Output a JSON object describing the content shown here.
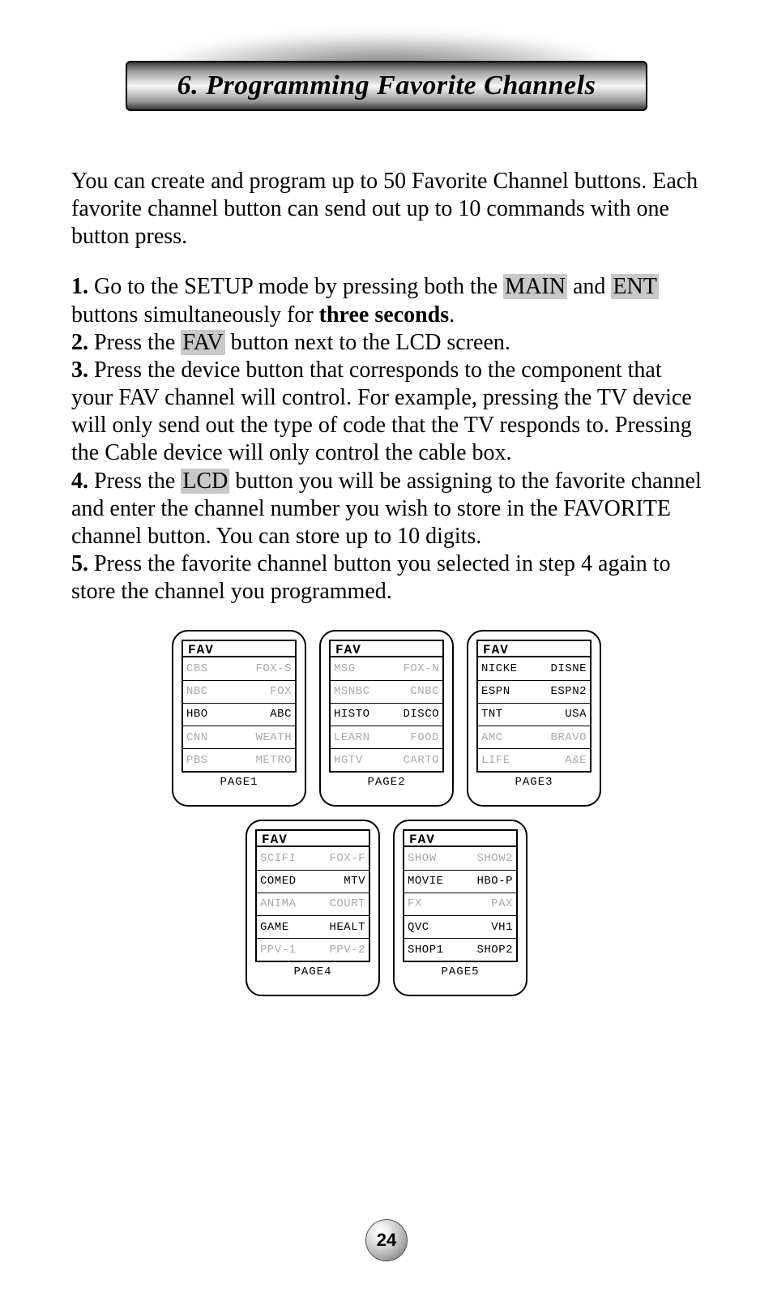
{
  "title": "6. Programming Favorite Channels",
  "intro": "You can create and program up to 50 Favorite Channel buttons. Each favorite channel button can send out up to 10 commands with one button press.",
  "steps": {
    "s1a": "1.",
    "s1b": " Go to the  SETUP mode by pressing both the ",
    "s1_main": "MAIN",
    "s1c": " and ",
    "s1_ent": "ENT",
    "s1d": " buttons simultaneously for ",
    "s1_three": "three seconds",
    "s1e": ".",
    "s2a": "2.",
    "s2b": " Press the ",
    "s2_fav": "FAV",
    "s2c": " button next to the LCD screen.",
    "s3a": "3.",
    "s3b": " Press the device button that corresponds to the component that your FAV channel will control. For example, pressing the TV device will only send out the type of code that the TV responds to. Pressing the Cable device will only control the cable box.",
    "s4a": "4.",
    "s4b": " Press the ",
    "s4_lcd": "LCD",
    "s4c": " button you will be assigning to the favorite channel and enter the channel number you wish to store in the FAVORITE channel button. You can store up to 10 digits.",
    "s5a": "5.",
    "s5b": " Press the favorite channel button you selected in step 4 again to store the channel you programmed."
  },
  "lcd_title": "FAV",
  "pages": [
    {
      "label": "PAGE1",
      "rows": [
        {
          "l": "CBS",
          "r": "FOX-S",
          "dim": true
        },
        {
          "l": "NBC",
          "r": "FOX",
          "dim": true
        },
        {
          "l": "HBO",
          "r": "ABC",
          "dim": false
        },
        {
          "l": "CNN",
          "r": "WEATH",
          "dim": true
        },
        {
          "l": "PBS",
          "r": "METRO",
          "dim": true
        }
      ]
    },
    {
      "label": "PAGE2",
      "rows": [
        {
          "l": "MSG",
          "r": "FOX-N",
          "dim": true
        },
        {
          "l": "MSNBC",
          "r": "CNBC",
          "dim": true
        },
        {
          "l": "HISTO",
          "r": "DISCO",
          "dim": false
        },
        {
          "l": "LEARN",
          "r": "FOOD",
          "dim": true
        },
        {
          "l": "HGTV",
          "r": "CARTO",
          "dim": true
        }
      ]
    },
    {
      "label": "PAGE3",
      "rows": [
        {
          "l": "NICKE",
          "r": "DISNE",
          "dim": false
        },
        {
          "l": "ESPN",
          "r": "ESPN2",
          "dim": false
        },
        {
          "l": "TNT",
          "r": "USA",
          "dim": false
        },
        {
          "l": "AMC",
          "r": "BRAVO",
          "dim": true
        },
        {
          "l": "LIFE",
          "r": "A&E",
          "dim": true
        }
      ]
    },
    {
      "label": "PAGE4",
      "rows": [
        {
          "l": "SCIFI",
          "r": "FOX-F",
          "dim": true
        },
        {
          "l": "COMED",
          "r": "MTV",
          "dim": false
        },
        {
          "l": "ANIMA",
          "r": "COURT",
          "dim": true
        },
        {
          "l": "GAME",
          "r": "HEALT",
          "dim": false
        },
        {
          "l": "PPV-1",
          "r": "PPV-2",
          "dim": true
        }
      ]
    },
    {
      "label": "PAGE5",
      "rows": [
        {
          "l": "SHOW",
          "r": "SHOW2",
          "dim": true
        },
        {
          "l": "MOVIE",
          "r": "HBO-P",
          "dim": false
        },
        {
          "l": "FX",
          "r": "PAX",
          "dim": true
        },
        {
          "l": "QVC",
          "r": "VH1",
          "dim": false
        },
        {
          "l": "SHOP1",
          "r": "SHOP2",
          "dim": false
        }
      ]
    }
  ],
  "page_number": "24"
}
